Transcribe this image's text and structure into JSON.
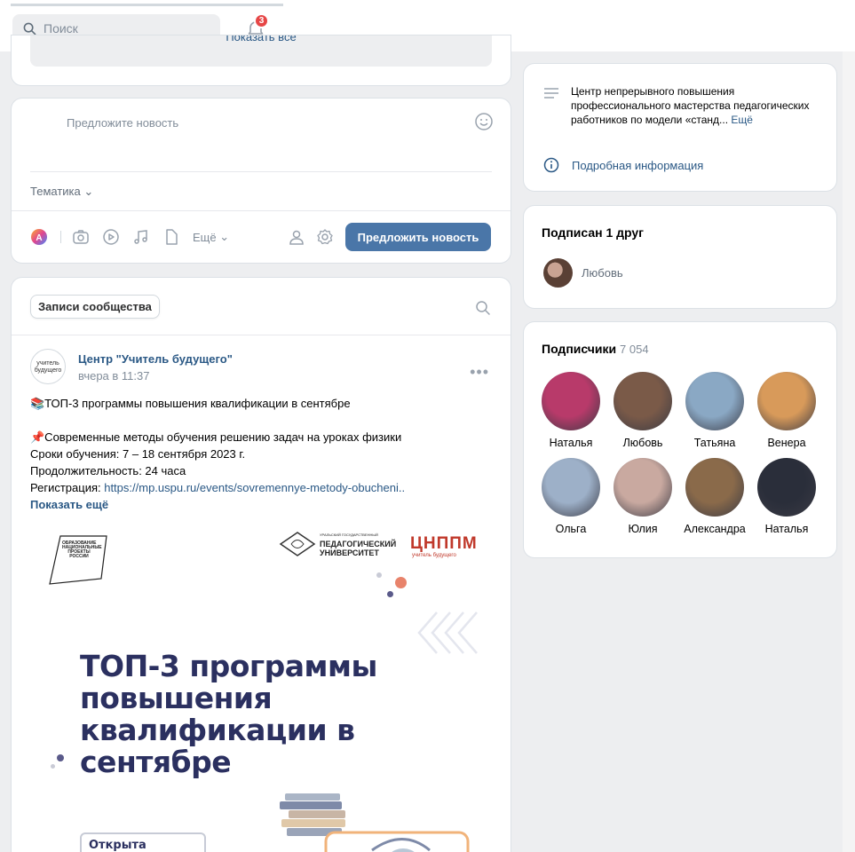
{
  "header": {
    "search_placeholder": "Поиск",
    "notifications_count": "3"
  },
  "wall": {
    "show_all_label": "Показать все",
    "suggest_placeholder": "Предложите новость",
    "topic_label": "Тематика",
    "more_label": "Ещё",
    "suggest_button": "Предложить новость"
  },
  "posts": {
    "tab_label": "Записи сообщества",
    "author_avatar_text": "учитель будущего",
    "author": "Центр \"Учитель будущего\"",
    "time": "вчера в 11:37",
    "line1": "📚ТОП-3 программы повышения квалификации в сентябре",
    "line2": "📌Современные методы обучения решению задач на уроках физики",
    "line3": "Сроки обучения: 7 – 18 сентября 2023 г.",
    "line4": "Продолжительность: 24 часа",
    "line5_prefix": "Регистрация: ",
    "line5_link": "https://mp.uspu.ru/events/sovremennye-metody-obucheni..",
    "show_more": "Показать ещё",
    "banner": {
      "logo_left": "ОБРАЗОВАНИЕ НАЦИОНАЛЬНЫЕ ПРОЕКТЫ РОССИИ",
      "uni_small": "УРАЛЬСКИЙ ГОСУДАРСТВЕННЫЙ",
      "uni_line1": "ПЕДАГОГИЧЕСКИЙ",
      "uni_line2": "УНИВЕРСИТЕТ",
      "cnppm": "ЦНППМ",
      "cnppm_sub": "учитель будущего",
      "title": "ТОП-3 программы повышения квалификации в сентябре",
      "reg": "Открыта регистрация"
    }
  },
  "info": {
    "text": "Центр непрерывного повышения профессионального мастерства педагогических работников по модели «станд...",
    "more": "Ещё",
    "details": "Подробная информация"
  },
  "friends": {
    "title": "Подписан 1 друг",
    "name": "Любовь"
  },
  "subscribers": {
    "title": "Подписчики",
    "count": "7 054",
    "items": [
      {
        "name": "Наталья",
        "color": "#b83a6a"
      },
      {
        "name": "Любовь",
        "color": "#7a5a48"
      },
      {
        "name": "Татьяна",
        "color": "#8aa8c4"
      },
      {
        "name": "Венера",
        "color": "#d89a5a"
      },
      {
        "name": "Ольга",
        "color": "#9db0c8"
      },
      {
        "name": "Юлия",
        "color": "#c9a9a0"
      },
      {
        "name": "Александра",
        "color": "#8a6a4a"
      },
      {
        "name": "Наталья",
        "color": "#2a2e3a"
      }
    ]
  },
  "colors": {
    "accent": "#4a76a8",
    "link": "#2a5885",
    "badge": "#e64646",
    "banner_title": "#2b3060"
  }
}
